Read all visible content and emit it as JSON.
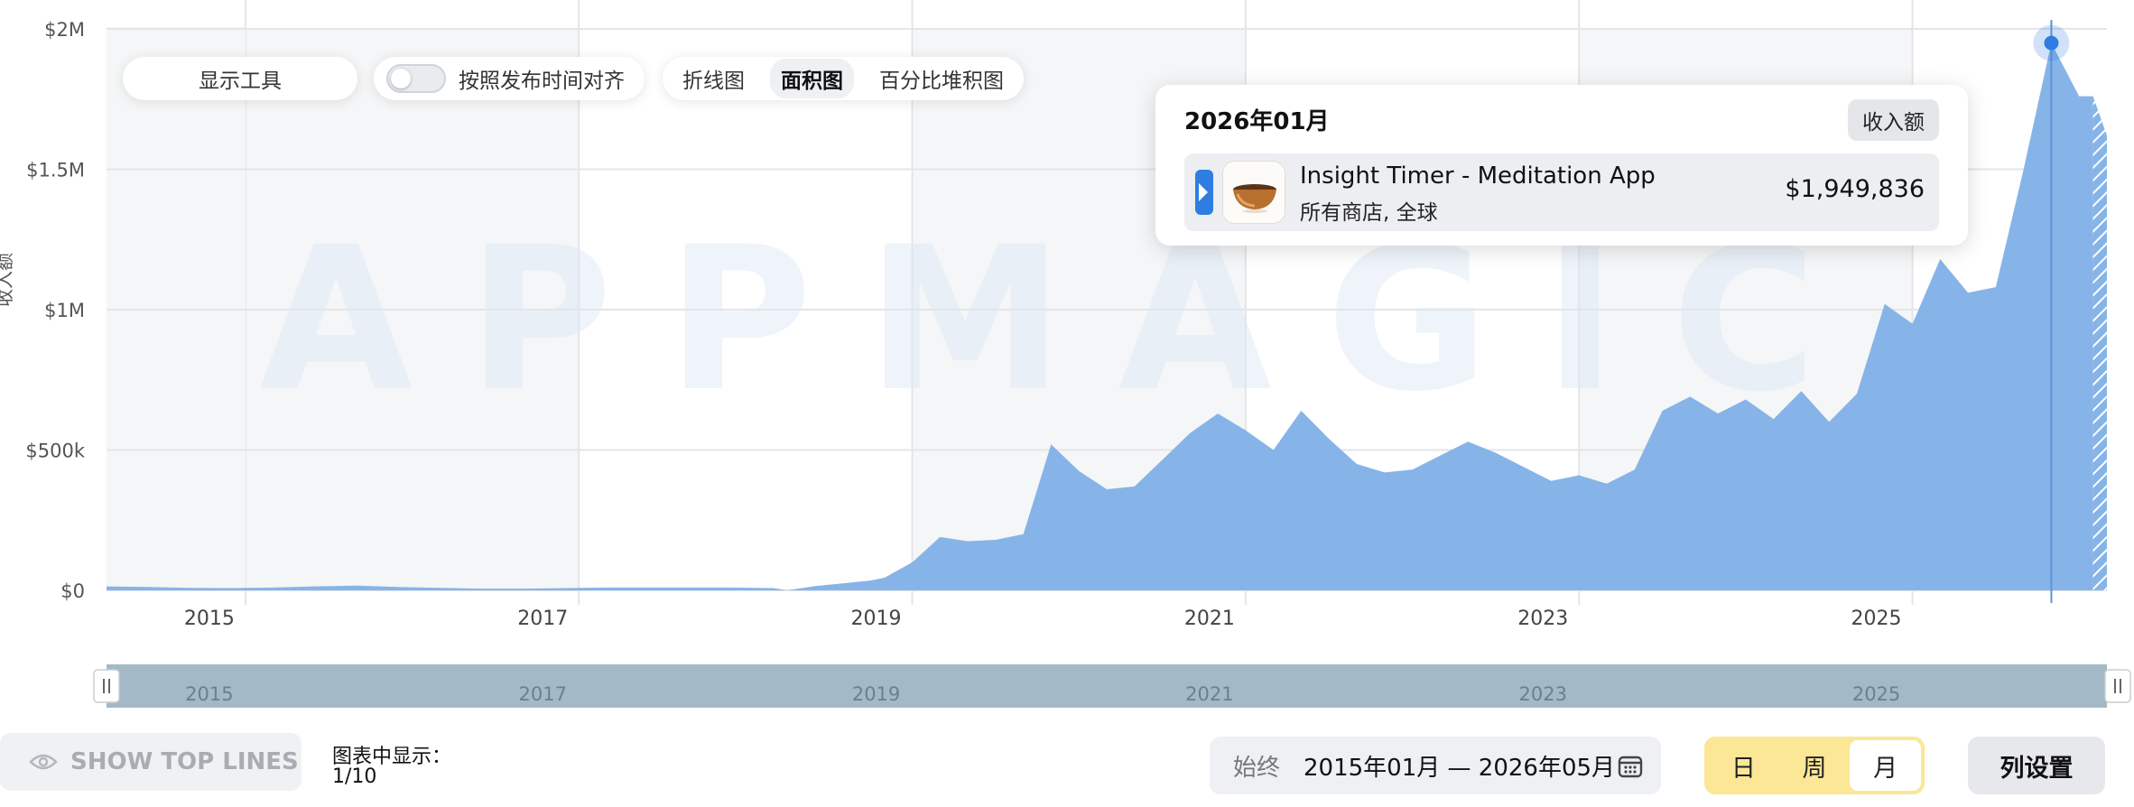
{
  "toolbar": {
    "tools_label": "显示工具",
    "align_label": "按照发布时间对齐",
    "chart_types": [
      "折线图",
      "面积图",
      "百分比堆积图"
    ],
    "active_chart_type": "面积图"
  },
  "watermark": "APPMAGIC",
  "tooltip": {
    "date": "2026年01月",
    "metric": "收入额",
    "app_name": "Insight Timer - Meditation App",
    "app_sub": "所有商店, 全球",
    "value": "$1,949,836"
  },
  "navigator": {
    "years": [
      "2015",
      "2017",
      "2019",
      "2021",
      "2023",
      "2025"
    ]
  },
  "footer": {
    "show_top_lines": "SHOW TOP LINES",
    "shown_label": "图表中显示：",
    "shown_count": "1/10",
    "range_prefix": "始终",
    "range_value": "2015年01月 — 2026年05月",
    "periods": [
      "日",
      "周",
      "月"
    ],
    "active_period": "月",
    "column_settings": "列设置"
  },
  "colors": {
    "area": "#86b4e8",
    "accent": "#2f7de1",
    "period_bg": "#fbe796",
    "navigator": "#a4b9c6"
  },
  "chart_data": {
    "type": "area",
    "ylabel": "收入额",
    "y_ticks": [
      {
        "value": 0,
        "label": "$0"
      },
      {
        "value": 500000,
        "label": "$500k"
      },
      {
        "value": 1000000,
        "label": "$1M"
      },
      {
        "value": 1500000,
        "label": "$1.5M"
      },
      {
        "value": 2000000,
        "label": "$2M"
      }
    ],
    "ylim": [
      0,
      2000000
    ],
    "x_ticks": [
      "2015",
      "2017",
      "2019",
      "2021",
      "2023",
      "2025"
    ],
    "x_start": "2014-05",
    "x_end": "2026-05",
    "highlight": {
      "x": "2026-01",
      "value": 1949836
    },
    "projected_from": "2026-04",
    "series": [
      {
        "name": "Insight Timer - Meditation App",
        "points": [
          [
            "2014-05",
            14000
          ],
          [
            "2014-08",
            12000
          ],
          [
            "2014-11",
            9000
          ],
          [
            "2015-02",
            8000
          ],
          [
            "2015-05",
            10000
          ],
          [
            "2015-08",
            14000
          ],
          [
            "2015-11",
            17000
          ],
          [
            "2016-02",
            12000
          ],
          [
            "2016-05",
            9000
          ],
          [
            "2016-08",
            6000
          ],
          [
            "2016-11",
            6000
          ],
          [
            "2017-02",
            8000
          ],
          [
            "2017-05",
            10000
          ],
          [
            "2017-08",
            10000
          ],
          [
            "2017-11",
            10000
          ],
          [
            "2018-02",
            10000
          ],
          [
            "2018-05",
            8000
          ],
          [
            "2018-06",
            0
          ],
          [
            "2018-08",
            15000
          ],
          [
            "2018-10",
            25000
          ],
          [
            "2018-12",
            35000
          ],
          [
            "2019-01",
            45000
          ],
          [
            "2019-03",
            100000
          ],
          [
            "2019-05",
            190000
          ],
          [
            "2019-07",
            175000
          ],
          [
            "2019-09",
            180000
          ],
          [
            "2019-11",
            200000
          ],
          [
            "2020-01",
            520000
          ],
          [
            "2020-03",
            425000
          ],
          [
            "2020-05",
            360000
          ],
          [
            "2020-07",
            370000
          ],
          [
            "2020-09",
            465000
          ],
          [
            "2020-11",
            560000
          ],
          [
            "2021-01",
            630000
          ],
          [
            "2021-03",
            570000
          ],
          [
            "2021-05",
            500000
          ],
          [
            "2021-07",
            640000
          ],
          [
            "2021-09",
            540000
          ],
          [
            "2021-11",
            450000
          ],
          [
            "2022-01",
            420000
          ],
          [
            "2022-03",
            430000
          ],
          [
            "2022-05",
            480000
          ],
          [
            "2022-07",
            530000
          ],
          [
            "2022-09",
            490000
          ],
          [
            "2022-11",
            440000
          ],
          [
            "2023-01",
            390000
          ],
          [
            "2023-03",
            410000
          ],
          [
            "2023-05",
            380000
          ],
          [
            "2023-07",
            430000
          ],
          [
            "2023-09",
            640000
          ],
          [
            "2023-11",
            690000
          ],
          [
            "2024-01",
            630000
          ],
          [
            "2024-03",
            680000
          ],
          [
            "2024-05",
            610000
          ],
          [
            "2024-07",
            710000
          ],
          [
            "2024-09",
            600000
          ],
          [
            "2024-11",
            700000
          ],
          [
            "2025-01",
            1020000
          ],
          [
            "2025-03",
            950000
          ],
          [
            "2025-05",
            1180000
          ],
          [
            "2025-07",
            1060000
          ],
          [
            "2025-09",
            1080000
          ],
          [
            "2025-11",
            1500000
          ],
          [
            "2026-01",
            1949836
          ],
          [
            "2026-03",
            1760000
          ],
          [
            "2026-04",
            1760000
          ],
          [
            "2026-05",
            1620000
          ]
        ]
      }
    ]
  }
}
